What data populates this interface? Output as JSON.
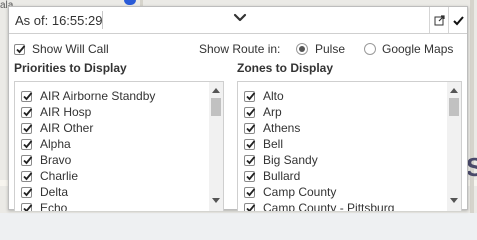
{
  "map": {
    "left_text": "ala",
    "right_letter": "S"
  },
  "header": {
    "as_of_label": "As of: 16:55:29"
  },
  "options": {
    "show_will_call": {
      "label": "Show Will Call",
      "checked": true
    },
    "show_route_label": "Show Route in:",
    "route_options": [
      {
        "label": "Pulse",
        "selected": true
      },
      {
        "label": "Google Maps",
        "selected": false
      }
    ]
  },
  "priorities": {
    "title": "Priorities to Display",
    "items": [
      {
        "label": "AIR Airborne Standby",
        "checked": true
      },
      {
        "label": "AIR Hosp",
        "checked": true
      },
      {
        "label": "AIR Other",
        "checked": true
      },
      {
        "label": "Alpha",
        "checked": true
      },
      {
        "label": "Bravo",
        "checked": true
      },
      {
        "label": "Charlie",
        "checked": true
      },
      {
        "label": "Delta",
        "checked": true
      },
      {
        "label": "Echo",
        "checked": true
      }
    ]
  },
  "zones": {
    "title": "Zones to Display",
    "items": [
      {
        "label": "Alto",
        "checked": true
      },
      {
        "label": "Arp",
        "checked": true
      },
      {
        "label": "Athens",
        "checked": true
      },
      {
        "label": "Bell",
        "checked": true
      },
      {
        "label": "Big Sandy",
        "checked": true
      },
      {
        "label": "Bullard",
        "checked": true
      },
      {
        "label": "Camp County",
        "checked": true
      },
      {
        "label": "Camp County - Pittsburg",
        "checked": true
      }
    ]
  },
  "colors": {
    "accent_blue": "#2a5bd7",
    "text": "#333333"
  },
  "icons": {
    "collapse": "chevron-down-icon",
    "popout": "external-link-icon",
    "confirm": "checkmark-icon"
  }
}
